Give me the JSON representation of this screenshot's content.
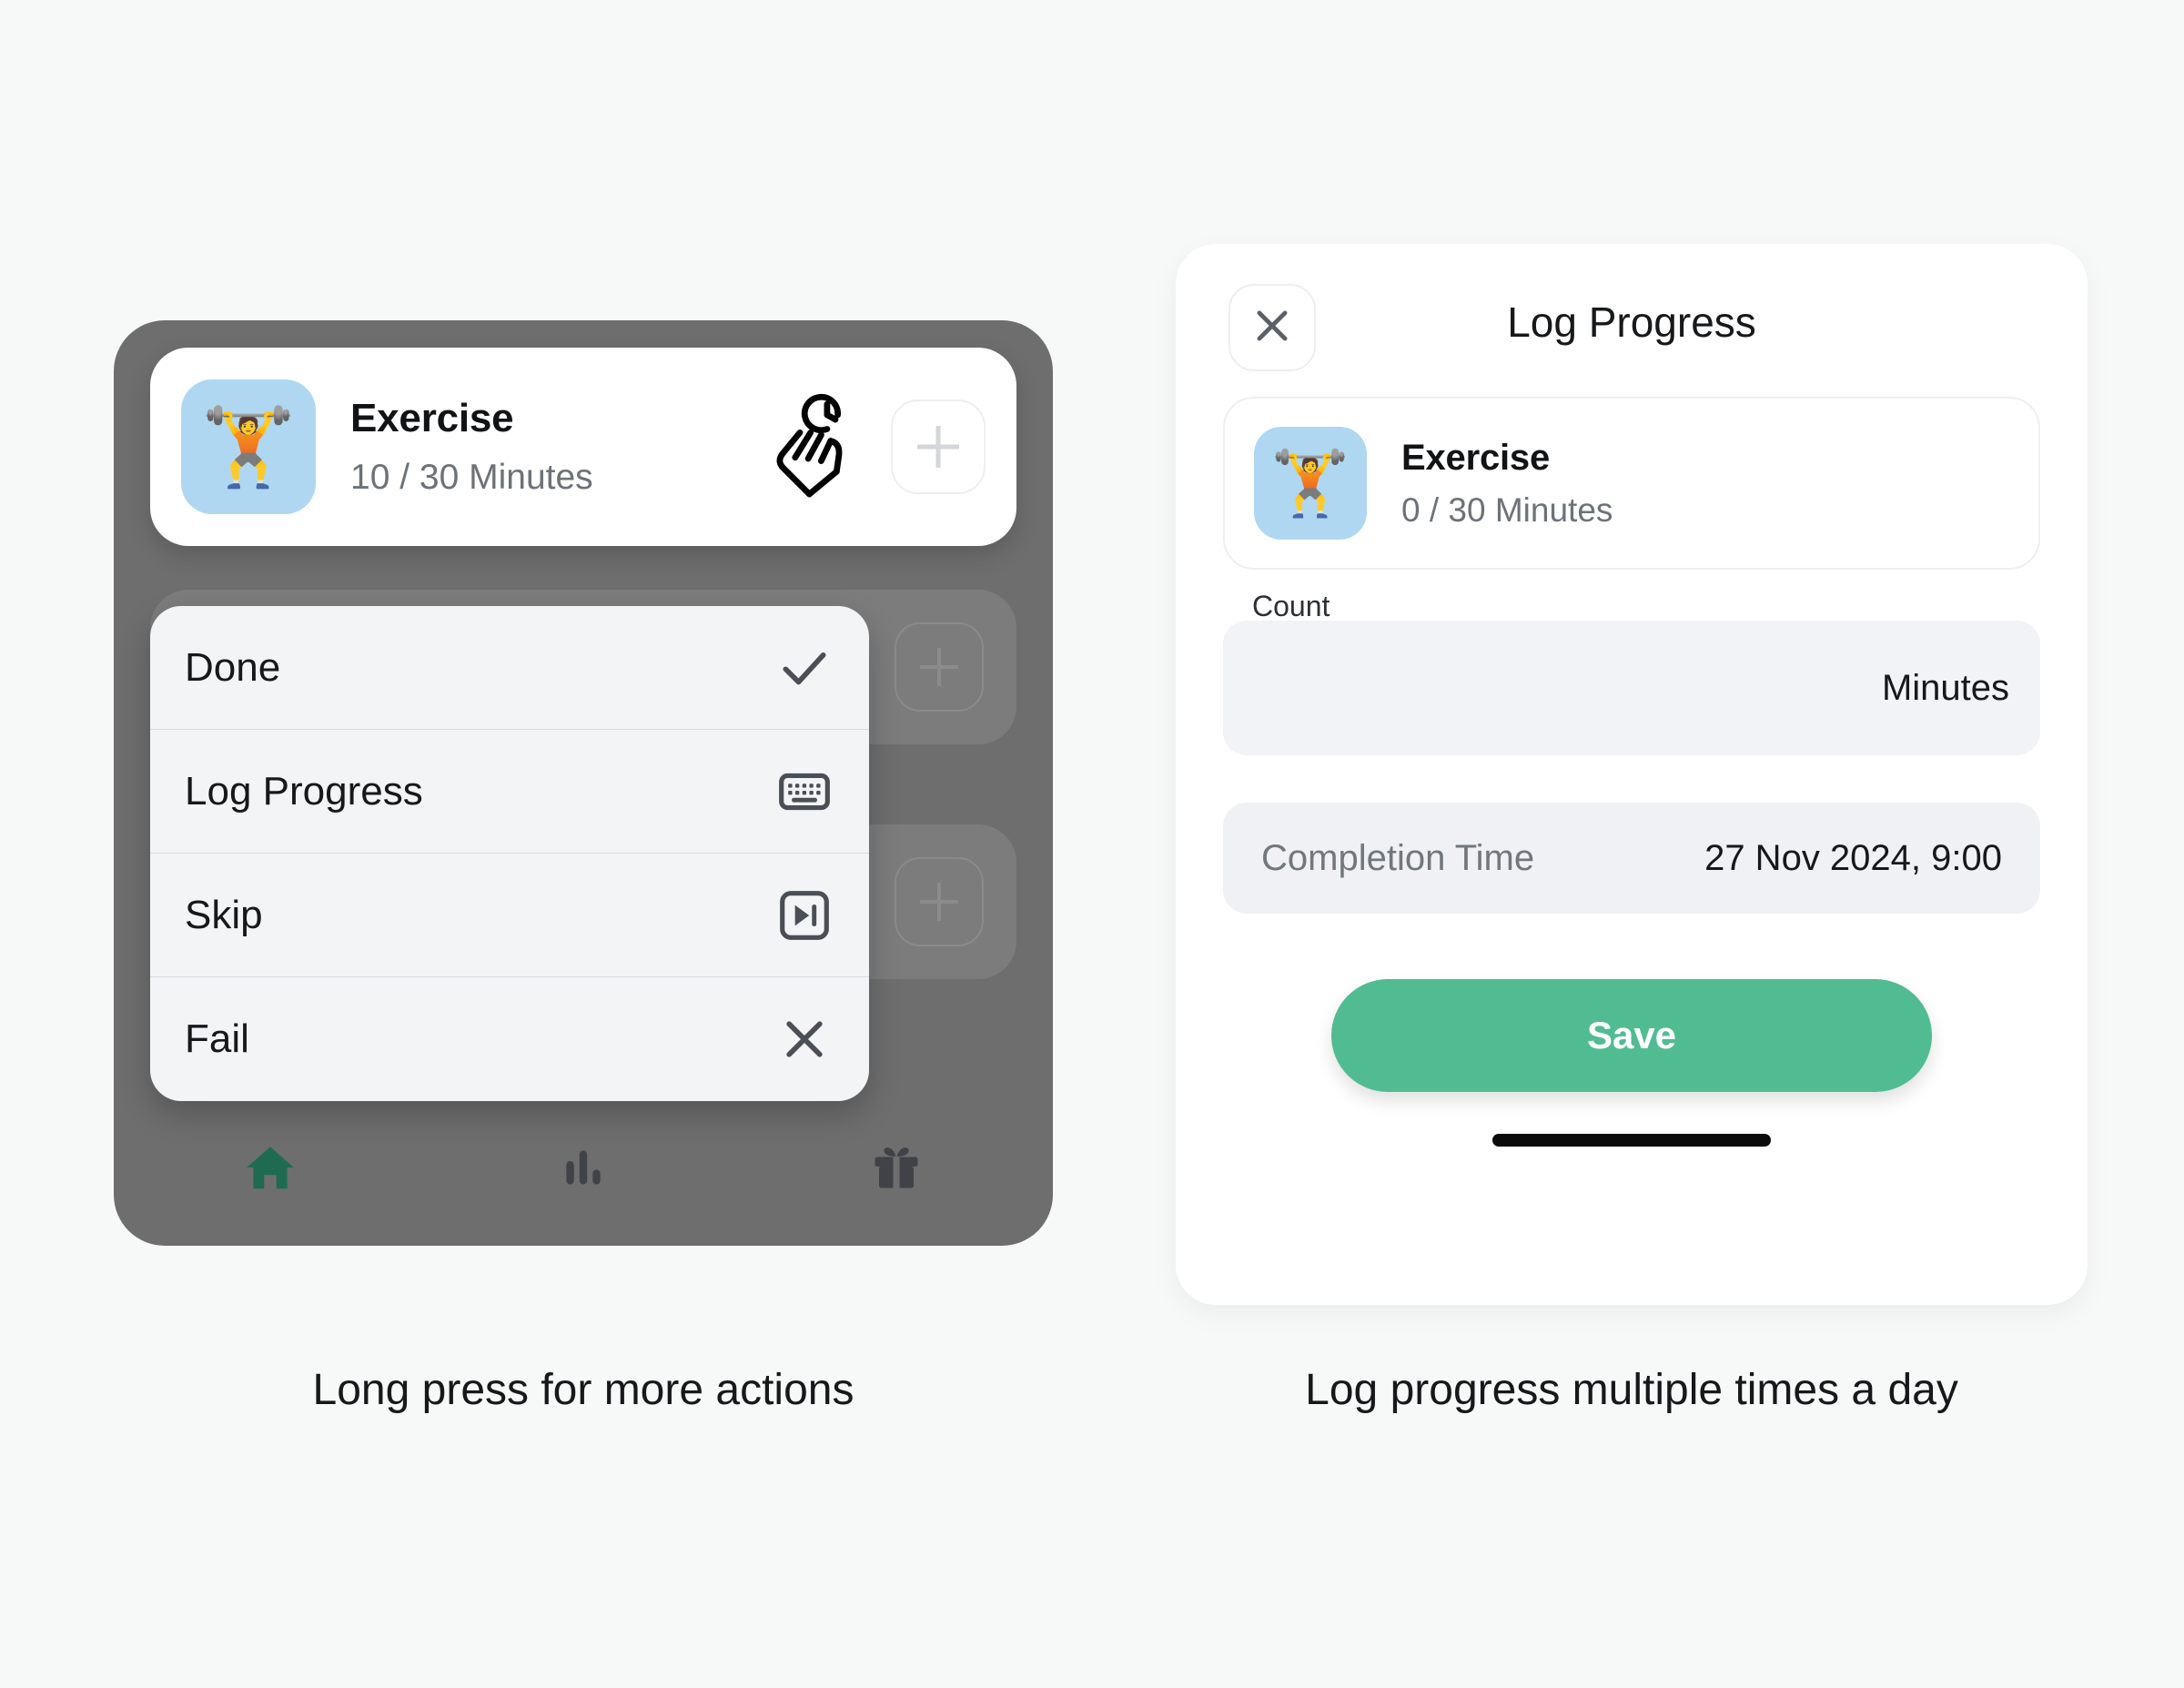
{
  "page": {
    "background_color": "#F7F8F8"
  },
  "left": {
    "caption": "Long press for more actions",
    "phone": {
      "frame_color": "#6E6E6E",
      "habit_card": {
        "emoji": "🏋️",
        "emoji_name": "weightlifter-emoji",
        "tile_color": "#AFD7F1",
        "title": "Exercise",
        "progress": "10 / 30 Minutes",
        "gesture_icon": "long-press-hand-clock-icon",
        "add_button_icon": "plus-icon"
      },
      "background_cards": [
        {
          "add_button_icon": "plus-icon"
        },
        {
          "add_button_icon": "plus-icon"
        }
      ],
      "context_menu": [
        {
          "label": "Done",
          "icon": "check-icon"
        },
        {
          "label": "Log Progress",
          "icon": "keyboard-icon"
        },
        {
          "label": "Skip",
          "icon": "skip-next-icon"
        },
        {
          "label": "Fail",
          "icon": "close-x-icon"
        }
      ],
      "bottom_nav": [
        {
          "icon": "home-icon",
          "active": true,
          "color": "#1E6B52"
        },
        {
          "icon": "bar-chart-icon",
          "active": false,
          "color": "#3F4347"
        },
        {
          "icon": "gift-icon",
          "active": false,
          "color": "#3F4347"
        }
      ]
    }
  },
  "right": {
    "caption": "Log progress multiple times a day",
    "sheet": {
      "close_icon": "close-x-icon",
      "title": "Log Progress",
      "habit": {
        "emoji": "🏋️",
        "emoji_name": "weightlifter-emoji",
        "tile_color": "#AFD7F1",
        "title": "Exercise",
        "progress": "0 / 30 Minutes"
      },
      "count_field": {
        "label": "Count",
        "value": "",
        "placeholder": "",
        "unit": "Minutes"
      },
      "completion": {
        "label": "Completion Time",
        "value": "27 Nov 2024, 9:00"
      },
      "save_label": "Save",
      "save_color": "#51BC92"
    }
  }
}
